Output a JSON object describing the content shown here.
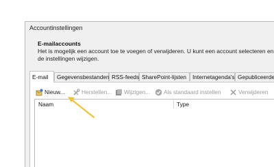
{
  "dialog": {
    "title": "Accountinstellingen",
    "section_heading": "E-mailaccounts",
    "description": "Het is mogelijk een account toe te voegen of verwijderen. U kunt een account selecteren en de instellingen wijzigen."
  },
  "tabs": [
    {
      "label": "E-mail",
      "active": true
    },
    {
      "label": "Gegevensbestanden",
      "active": false
    },
    {
      "label": "RSS-feeds",
      "active": false
    },
    {
      "label": "SharePoint-lijsten",
      "active": false
    },
    {
      "label": "Internetagenda's",
      "active": false
    },
    {
      "label": "Gepubliceerde",
      "active": false
    }
  ],
  "toolbar": {
    "new_label": "Nieuw...",
    "repair_label": "Herstellen...",
    "change_label": "Wijzigen...",
    "default_label": "Als standaard instellen",
    "remove_label": "Verwijderen"
  },
  "list": {
    "columns": [
      "Naam",
      "Type"
    ]
  },
  "colors": {
    "annotation_arrow": "#f2c230",
    "disabled_text": "#9a9a9a"
  }
}
